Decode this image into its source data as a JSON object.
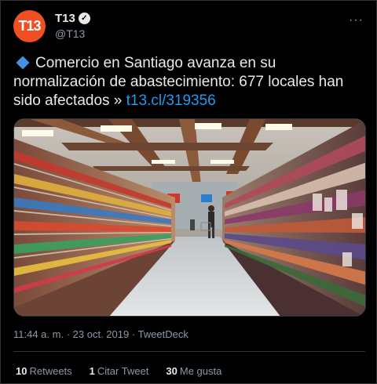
{
  "author": {
    "avatar_text": "T13",
    "display_name": "T13",
    "handle": "@T13",
    "verified_icon": "✓"
  },
  "more_icon": "···",
  "tweet": {
    "text": "Comercio en Santiago avanza en su normalización de abastecimiento: 677 locales han sido afectados » ",
    "link": "t13.cl/319356"
  },
  "meta": {
    "time": "11:44 a. m.",
    "separator": "·",
    "date": "23 oct. 2019",
    "source": "TweetDeck"
  },
  "stats": {
    "retweets_count": "10",
    "retweets_label": "Retweets",
    "quotes_count": "1",
    "quotes_label": "Citar Tweet",
    "likes_count": "30",
    "likes_label": "Me gusta"
  },
  "colors": {
    "link": "#1d9bf0",
    "avatar": "#f04e23",
    "background": "#000000"
  }
}
